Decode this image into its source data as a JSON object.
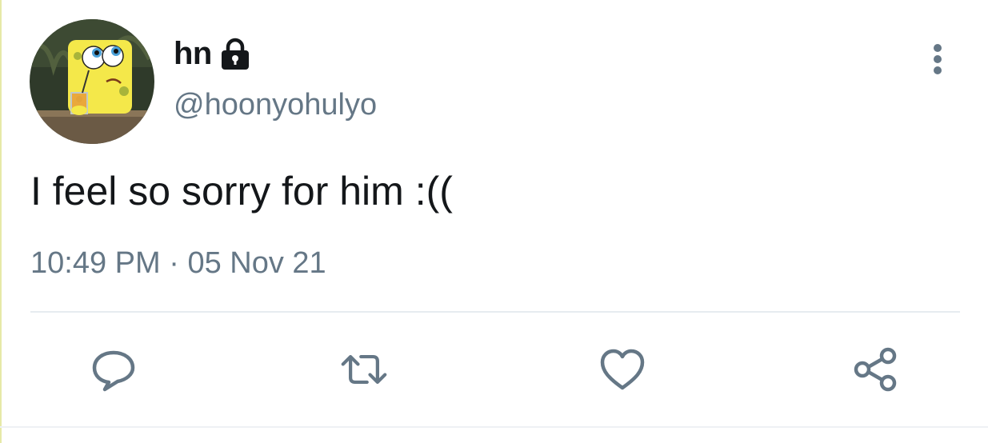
{
  "tweet": {
    "author": {
      "display_name": "hn",
      "handle": "@hoonyohulyo",
      "protected_icon": "lock-icon",
      "avatar": "spongebob-avatar"
    },
    "text": "I feel so sorry for him :((",
    "time": "10:49 PM",
    "separator": " · ",
    "date": "05 Nov 21",
    "actions": {
      "reply": "reply-icon",
      "retweet": "retweet-icon",
      "like": "heart-icon",
      "share": "share-icon",
      "more": "more-vertical-icon"
    }
  },
  "colors": {
    "text_primary": "#14171a",
    "text_secondary": "#657786",
    "icon": "#657786",
    "divider": "#e6ecf0"
  }
}
